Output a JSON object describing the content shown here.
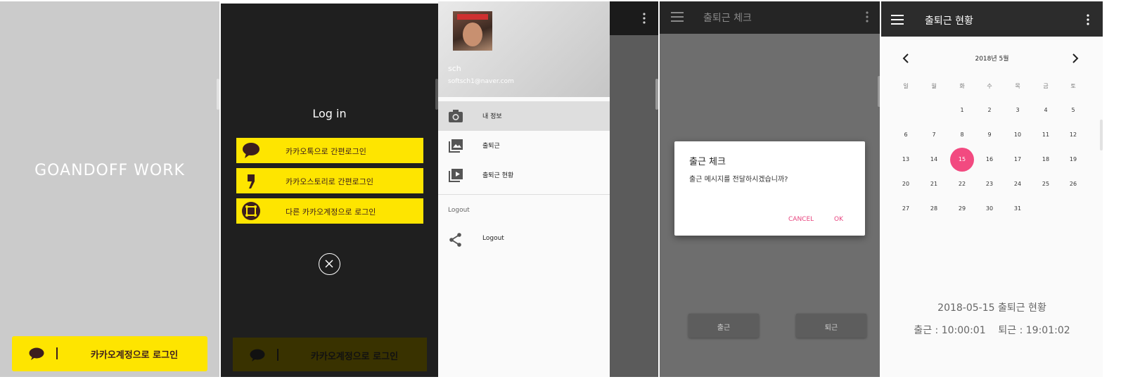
{
  "splash": {
    "brand": "GOANDOFF WORK",
    "kakao_login_label": "카카오계정으로 로그인"
  },
  "login": {
    "title": "Log in",
    "options": [
      {
        "label": "카카오톡으로 간편로그인",
        "icon": "speech-bubble-icon"
      },
      {
        "label": "카카오스토리로 간편로그인",
        "icon": "kakaostory-icon"
      },
      {
        "label": "다른 카카오계정으로 로그인",
        "icon": "kakao-account-icon"
      }
    ],
    "kakao_login_label": "카카오계정으로 로그인"
  },
  "drawer": {
    "user_name": "sch",
    "user_email": "softsch1@naver.com",
    "items": [
      {
        "label": "내 정보",
        "icon": "camera-icon"
      },
      {
        "label": "출퇴근",
        "icon": "gallery-icon"
      },
      {
        "label": "출퇴근 현황",
        "icon": "slideshow-icon"
      }
    ],
    "section_title": "Logout",
    "logout_label": "Logout"
  },
  "checkin": {
    "app_title": "출퇴근 체크",
    "dialog_title": "출근 체크",
    "dialog_message": "출근 메시지를 전달하시겠습니까?",
    "cancel_label": "CANCEL",
    "ok_label": "OK",
    "checkin_button": "출근",
    "checkout_button": "퇴근"
  },
  "calendar": {
    "app_title": "출퇴근 현황",
    "month_label": "2018년 5월",
    "weekdays": [
      "일",
      "월",
      "화",
      "수",
      "목",
      "금",
      "토"
    ],
    "first_weekday_index": 2,
    "days_in_month": 31,
    "selected_day": 15,
    "summary_title": "2018-05-15 출퇴근 현황",
    "summary_times": "출근 : 10:00:01    퇴근 : 19:01:02"
  },
  "colors": {
    "kakao_yellow": "#fee500",
    "kakao_brown": "#3c1e1e",
    "accent_pink": "#f24a80"
  }
}
